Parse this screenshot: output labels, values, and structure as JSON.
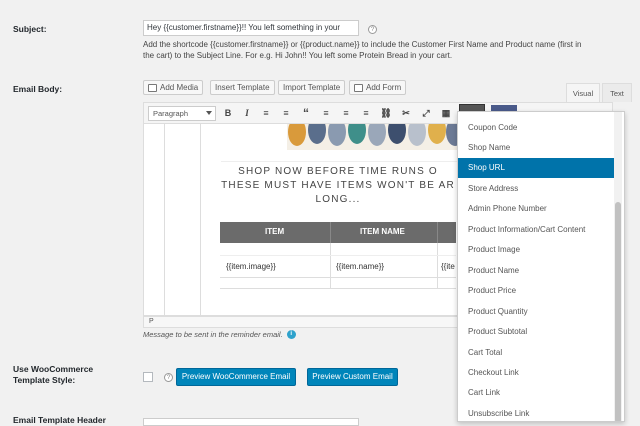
{
  "subject": {
    "label": "Subject:",
    "value": "Hey {{customer.firstname}}!! You left something in your",
    "help": "?",
    "description_line1": "Add the shortcode {{customer.firstname}} or {{product.name}} to include the Customer First Name and Product name (first in",
    "description_line2": "the cart) to the Subject Line. For e.g. Hi John!! You left some Protein Bread in your cart."
  },
  "email_body": {
    "label": "Email Body:",
    "buttons": {
      "add_media": "Add Media",
      "insert_template": "Insert Template",
      "import_template": "Import Template",
      "add_form": "Add Form"
    },
    "tabs": {
      "visual": "Visual",
      "text": "Text"
    },
    "format_select": "Paragraph",
    "toolbar": {
      "bold": "B",
      "italic": "I",
      "bullet": "≡",
      "numbered": "≡",
      "quote": "“",
      "align_left": "≡",
      "align_center": "≡",
      "align_right": "≡",
      "link": "⛓",
      "unlink": "✂",
      "fullscreen": "⤢",
      "table": "▦"
    },
    "banner_line1": "SHOP NOW BEFORE TIME RUNS O",
    "banner_line2": "THESE MUST HAVE ITEMS WON'T BE AR",
    "banner_line3": "LONG...",
    "table": {
      "headers": [
        "ITEM",
        "ITEM NAME",
        ""
      ],
      "row": [
        "{{item.image}}",
        "{{item.name}}",
        "{{ite"
      ]
    },
    "status_path": "P",
    "hint": "Message to be sent in the reminder email."
  },
  "dropdown": {
    "items": [
      "Coupon Code",
      "Shop Name",
      "Shop URL",
      "Store Address",
      "Admin Phone Number",
      "Product Information/Cart Content",
      "Product Image",
      "Product Name",
      "Product Price",
      "Product Quantity",
      "Product Subtotal",
      "Cart Total",
      "Checkout Link",
      "Cart Link",
      "Unsubscribe Link"
    ],
    "selected": "Shop URL"
  },
  "woo": {
    "label_line1": "Use WooCommerce",
    "label_line2": "Template Style:",
    "help": "?",
    "preview_woo": "Preview WooCommerce Email",
    "preview_custom": "Preview Custom Email"
  },
  "template_header": {
    "label": "Email Template Header"
  },
  "colors": {
    "primary": "#0085ba",
    "selected": "#0073aa"
  }
}
